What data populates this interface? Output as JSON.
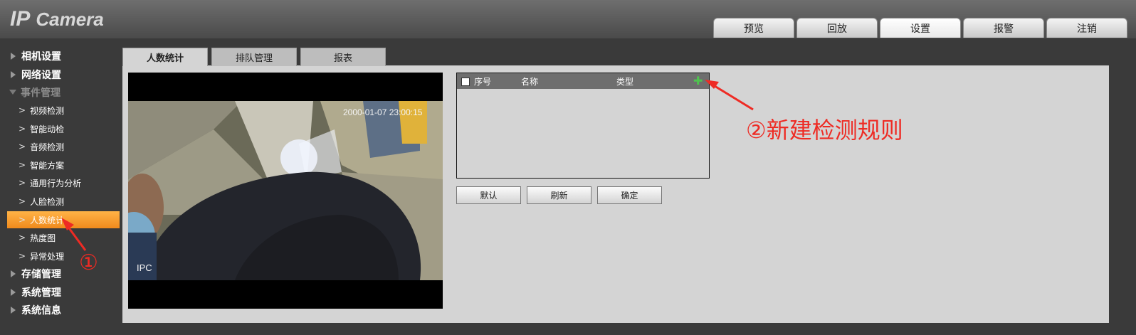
{
  "header": {
    "logo_ip": "IP",
    "logo_camera": "Camera"
  },
  "top_tabs": [
    "预览",
    "回放",
    "设置",
    "报警",
    "注销"
  ],
  "active_top_tab": "设置",
  "sidebar": {
    "camera_settings": "相机设置",
    "network_settings": "网络设置",
    "event_management": "事件管理",
    "sub_items": [
      "视频检测",
      "智能动检",
      "音频检测",
      "智能方案",
      "通用行为分析",
      "人脸检测",
      "人数统计",
      "热度图",
      "异常处理"
    ],
    "active_sub_item": "人数统计",
    "storage_management": "存储管理",
    "system_management": "系统管理",
    "system_info": "系统信息"
  },
  "sub_tabs": [
    "人数统计",
    "排队管理",
    "报表"
  ],
  "video": {
    "timestamp": "2000-01-07 23:00:15",
    "channel_label": "IPC"
  },
  "rule_table": {
    "columns": [
      "序号",
      "名称",
      "类型"
    ]
  },
  "buttons": {
    "default": "默认",
    "refresh": "刷新",
    "confirm": "确定"
  },
  "annotations": {
    "step1": "①",
    "step2": "②新建检测规则"
  },
  "colors": {
    "accent_orange": "#f08a1c",
    "annotation_red": "#ee2b24",
    "add_green": "#4fc24f"
  }
}
